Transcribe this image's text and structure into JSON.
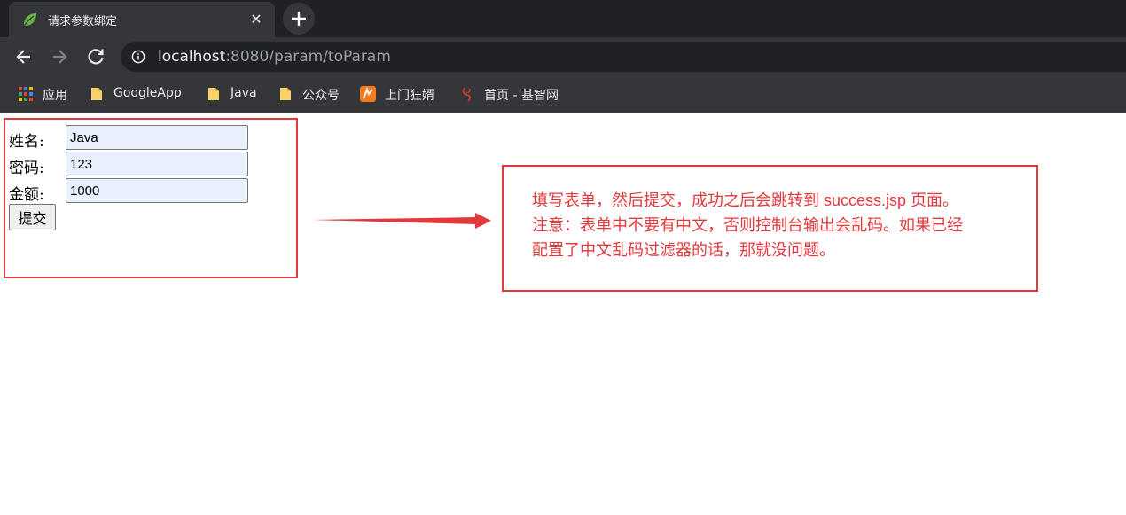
{
  "browser": {
    "tab_title": "请求参数绑定",
    "tab_close": "✕",
    "url_host": "localhost",
    "url_rest": ":8080/param/toParam"
  },
  "bookmarks": [
    {
      "label": "应用",
      "icon": "apps-grid-icon"
    },
    {
      "label": "GoogleApp",
      "icon": "folder-icon"
    },
    {
      "label": "Java",
      "icon": "folder-icon"
    },
    {
      "label": "公众号",
      "icon": "folder-icon"
    },
    {
      "label": "上门狂婿",
      "icon": "novel-site-icon"
    },
    {
      "label": "首页 - 基智网",
      "icon": "jizhi-site-icon"
    }
  ],
  "form": {
    "fields": [
      {
        "label": "姓名:",
        "value": "Java"
      },
      {
        "label": "密码:",
        "value": "123"
      },
      {
        "label": "金额:",
        "value": "1000"
      }
    ],
    "submit_label": "提交"
  },
  "annotation": {
    "lines": [
      "填写表单，然后提交，成功之后会跳转到 success.jsp 页面。",
      "注意：表单中不要有中文，否则控制台输出会乱码。如果已经",
      "配置了中文乱码过滤器的话，那就没问题。"
    ],
    "color": "#e4393c"
  },
  "colors": {
    "chrome_dark": "#202124",
    "chrome_mid": "#35363a",
    "autofill_bg": "#e8f0fe",
    "accent_red": "#e4393c"
  }
}
